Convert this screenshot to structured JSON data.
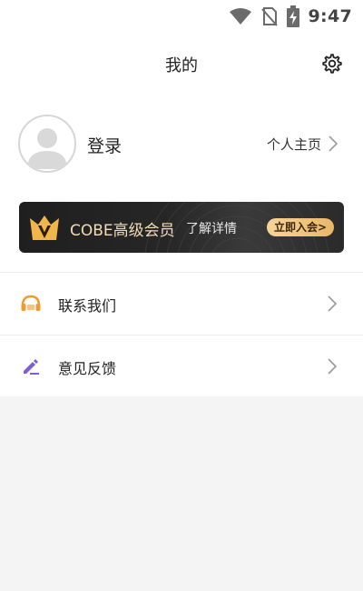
{
  "status_bar": {
    "time": "9:47",
    "icons": [
      "wifi-icon",
      "no-sim-icon",
      "battery-charging-icon"
    ]
  },
  "header": {
    "title": "我的",
    "settings_icon": "gear-icon"
  },
  "profile": {
    "login_label": "登录",
    "home_label": "个人主页",
    "avatar_icon": "default-avatar-icon"
  },
  "vip": {
    "title": "COBE高级会员",
    "subtitle": "了解详情",
    "join_label": "立即入会>",
    "crown_icon": "vip-crown-icon",
    "accent_color": "#f3dcb2"
  },
  "menu": [
    {
      "label": "联系我们",
      "icon": "headset-icon",
      "icon_color": "#f39a2b"
    },
    {
      "label": "意见反馈",
      "icon": "edit-pencil-icon",
      "icon_color": "#7b5fd6"
    }
  ]
}
